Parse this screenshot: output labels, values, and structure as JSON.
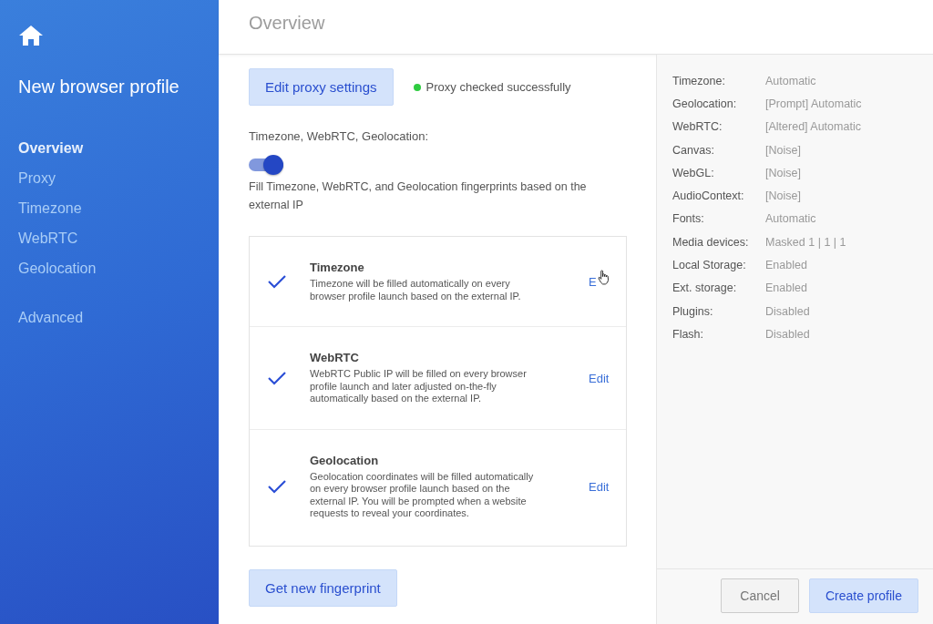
{
  "sidebar": {
    "title": "New browser profile",
    "groups": [
      {
        "items": [
          {
            "label": "Overview",
            "selected": true
          },
          {
            "label": "Proxy",
            "selected": false
          },
          {
            "label": "Timezone",
            "selected": false
          },
          {
            "label": "WebRTC",
            "selected": false
          },
          {
            "label": "Geolocation",
            "selected": false
          }
        ]
      },
      {
        "items": [
          {
            "label": "Advanced",
            "selected": false
          }
        ]
      }
    ]
  },
  "header": {
    "title": "Overview"
  },
  "proxy": {
    "button": "Edit proxy settings",
    "status": "Proxy checked successfully",
    "ok": true
  },
  "auto_fill": {
    "label": "Timezone, WebRTC, Geolocation:",
    "on": true,
    "description": "Fill Timezone, WebRTC, and Geolocation fingerprints based on the external IP"
  },
  "features": [
    {
      "title": "Timezone",
      "description": "Timezone will be filled automatically on every browser profile launch based on the external IP.",
      "checked": true,
      "action": "E",
      "hovered": true
    },
    {
      "title": "WebRTC",
      "description": "WebRTC Public IP will be filled on every browser profile launch and later adjusted on-the-fly automatically based on the external IP.",
      "checked": true,
      "action": "Edit",
      "hovered": false
    },
    {
      "title": "Geolocation",
      "description": "Geolocation coordinates will be filled automatically on every browser profile launch based on the external IP. You will be prompted when a website requests to reveal your coordinates.",
      "checked": true,
      "action": "Edit",
      "hovered": false
    }
  ],
  "fingerprint_button": "Get new fingerprint",
  "summary": [
    {
      "label": "Timezone:",
      "value": "Automatic"
    },
    {
      "label": "Geolocation:",
      "value": "[Prompt] Automatic"
    },
    {
      "label": "WebRTC:",
      "value": "[Altered] Automatic"
    },
    {
      "label": "Canvas:",
      "value": "[Noise]"
    },
    {
      "label": "WebGL:",
      "value": "[Noise]"
    },
    {
      "label": "AudioContext:",
      "value": "[Noise]"
    },
    {
      "label": "Fonts:",
      "value": "Automatic"
    },
    {
      "label": "Media devices:",
      "value": "Masked 1 | 1 | 1"
    },
    {
      "label": "Local Storage:",
      "value": "Enabled"
    },
    {
      "label": "Ext. storage:",
      "value": "Enabled"
    },
    {
      "label": "Plugins:",
      "value": "Disabled"
    },
    {
      "label": "Flash:",
      "value": "Disabled"
    }
  ],
  "footer": {
    "cancel": "Cancel",
    "create": "Create profile"
  }
}
